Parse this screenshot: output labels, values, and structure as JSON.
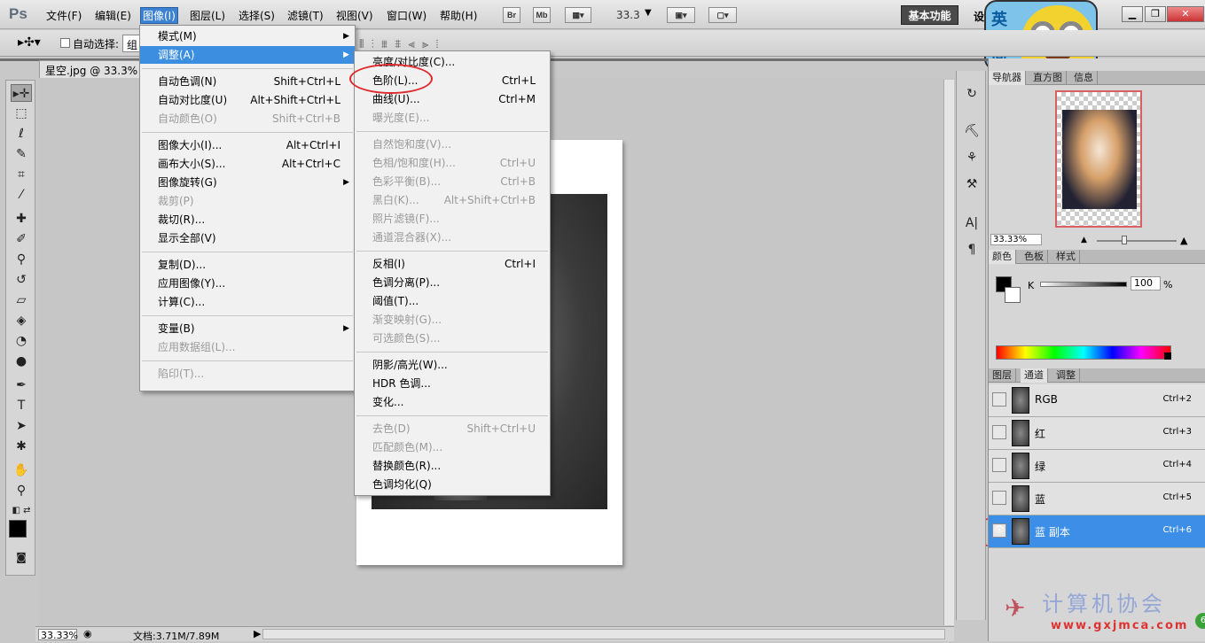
{
  "app": {
    "logo": "Ps"
  },
  "menubar": {
    "items": [
      "文件(F)",
      "编辑(E)",
      "图像(I)",
      "图层(L)",
      "选择(S)",
      "滤镜(T)",
      "视图(V)",
      "窗口(W)",
      "帮助(H)"
    ],
    "bridge_btn": "Br",
    "minibridge_btn": "Mb",
    "zoom": "33.3",
    "workspace": "基本功能",
    "workspace_extra": "设"
  },
  "options_bar": {
    "auto_select_label": "自动选择:",
    "auto_select_value": "组"
  },
  "document": {
    "tab_title": "星空.jpg @ 33.3% (",
    "zoom": "33.33%",
    "doc_size": "文档:3.71M/7.89M"
  },
  "image_menu": {
    "items": [
      {
        "label": "模式(M)",
        "shortcut": "",
        "submenu": true,
        "disabled": false
      },
      {
        "label": "调整(A)",
        "shortcut": "",
        "submenu": true,
        "disabled": false,
        "highlighted": true
      },
      {
        "label": "自动色调(N)",
        "shortcut": "Shift+Ctrl+L",
        "disabled": false
      },
      {
        "label": "自动对比度(U)",
        "shortcut": "Alt+Shift+Ctrl+L",
        "disabled": false
      },
      {
        "label": "自动颜色(O)",
        "shortcut": "Shift+Ctrl+B",
        "disabled": true
      },
      {
        "label": "图像大小(I)...",
        "shortcut": "Alt+Ctrl+I",
        "disabled": false
      },
      {
        "label": "画布大小(S)...",
        "shortcut": "Alt+Ctrl+C",
        "disabled": false
      },
      {
        "label": "图像旋转(G)",
        "shortcut": "",
        "submenu": true,
        "disabled": false
      },
      {
        "label": "裁剪(P)",
        "shortcut": "",
        "disabled": true
      },
      {
        "label": "裁切(R)...",
        "shortcut": "",
        "disabled": false
      },
      {
        "label": "显示全部(V)",
        "shortcut": "",
        "disabled": false
      },
      {
        "label": "复制(D)...",
        "shortcut": "",
        "disabled": false
      },
      {
        "label": "应用图像(Y)...",
        "shortcut": "",
        "disabled": false
      },
      {
        "label": "计算(C)...",
        "shortcut": "",
        "disabled": false
      },
      {
        "label": "变量(B)",
        "shortcut": "",
        "submenu": true,
        "disabled": false
      },
      {
        "label": "应用数据组(L)...",
        "shortcut": "",
        "disabled": true
      },
      {
        "label": "陷印(T)...",
        "shortcut": "",
        "disabled": true
      }
    ]
  },
  "adjust_menu": {
    "items": [
      {
        "label": "亮度/对比度(C)...",
        "shortcut": "",
        "disabled": false
      },
      {
        "label": "色阶(L)...",
        "shortcut": "Ctrl+L",
        "disabled": false
      },
      {
        "label": "曲线(U)...",
        "shortcut": "Ctrl+M",
        "disabled": false
      },
      {
        "label": "曝光度(E)...",
        "shortcut": "",
        "disabled": true
      },
      {
        "label": "自然饱和度(V)...",
        "shortcut": "",
        "disabled": true
      },
      {
        "label": "色相/饱和度(H)...",
        "shortcut": "Ctrl+U",
        "disabled": true
      },
      {
        "label": "色彩平衡(B)...",
        "shortcut": "Ctrl+B",
        "disabled": true
      },
      {
        "label": "黑白(K)...",
        "shortcut": "Alt+Shift+Ctrl+B",
        "disabled": true
      },
      {
        "label": "照片滤镜(F)...",
        "shortcut": "",
        "disabled": true
      },
      {
        "label": "通道混合器(X)...",
        "shortcut": "",
        "disabled": true
      },
      {
        "label": "反相(I)",
        "shortcut": "Ctrl+I",
        "disabled": false
      },
      {
        "label": "色调分离(P)...",
        "shortcut": "",
        "disabled": false
      },
      {
        "label": "阈值(T)...",
        "shortcut": "",
        "disabled": false
      },
      {
        "label": "渐变映射(G)...",
        "shortcut": "",
        "disabled": true
      },
      {
        "label": "可选颜色(S)...",
        "shortcut": "",
        "disabled": true
      },
      {
        "label": "阴影/高光(W)...",
        "shortcut": "",
        "disabled": false
      },
      {
        "label": "HDR 色调...",
        "shortcut": "",
        "disabled": false
      },
      {
        "label": "变化...",
        "shortcut": "",
        "disabled": false
      },
      {
        "label": "去色(D)",
        "shortcut": "Shift+Ctrl+U",
        "disabled": true
      },
      {
        "label": "匹配颜色(M)...",
        "shortcut": "",
        "disabled": true
      },
      {
        "label": "替换颜色(R)...",
        "shortcut": "",
        "disabled": false
      },
      {
        "label": "色调均化(Q)",
        "shortcut": "",
        "disabled": false
      }
    ]
  },
  "navigator_panel": {
    "tabs": [
      "导航器",
      "直方图",
      "信息"
    ],
    "zoom": "33.33%"
  },
  "color_panel": {
    "tabs": [
      "颜色",
      "色板",
      "样式"
    ],
    "channel_label": "K",
    "value": "100",
    "unit": "%"
  },
  "channels_panel": {
    "tabs": [
      "图层",
      "通道",
      "调整"
    ],
    "rows": [
      {
        "name": "RGB",
        "shortcut": "Ctrl+2",
        "visible": false,
        "selected": false
      },
      {
        "name": "红",
        "shortcut": "Ctrl+3",
        "visible": false,
        "selected": false
      },
      {
        "name": "绿",
        "shortcut": "Ctrl+4",
        "visible": false,
        "selected": false
      },
      {
        "name": "蓝",
        "shortcut": "Ctrl+5",
        "visible": false,
        "selected": false
      },
      {
        "name": "蓝 副本",
        "shortcut": "Ctrl+6",
        "visible": true,
        "selected": true
      }
    ]
  },
  "watermark": {
    "text": "计算机协会",
    "url": "www.gxjmca.com"
  },
  "badge": {
    "text1": "英",
    "text2": "简"
  },
  "colors": {
    "menu_highlight": "#3b8ee0",
    "annotation_red": "#e0292e",
    "selected_channel": "#3d8ee6"
  }
}
